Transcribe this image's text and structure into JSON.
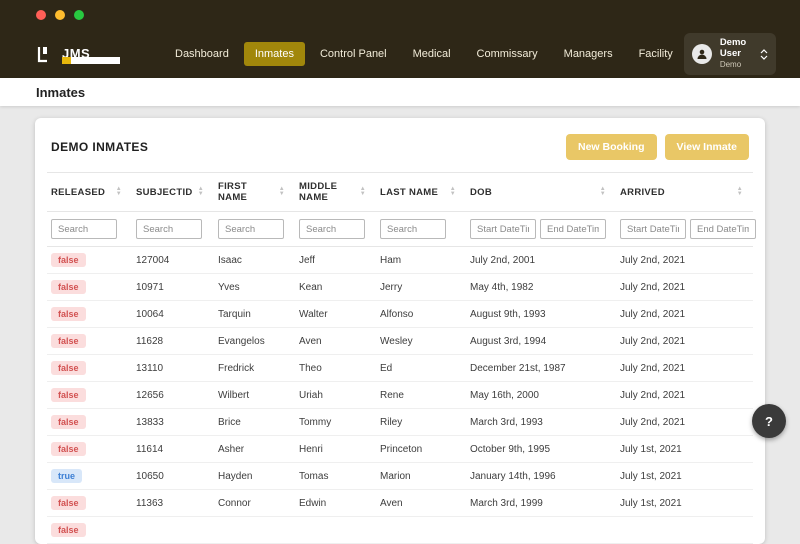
{
  "window": {
    "traffic_lights": [
      {
        "name": "close",
        "color": "#ff5f57"
      },
      {
        "name": "minimize",
        "color": "#febc2e"
      },
      {
        "name": "zoom",
        "color": "#28c840"
      }
    ]
  },
  "header": {
    "logo_text": "JMS",
    "nav": [
      {
        "label": "Dashboard",
        "active": false
      },
      {
        "label": "Inmates",
        "active": true
      },
      {
        "label": "Control Panel",
        "active": false
      },
      {
        "label": "Medical",
        "active": false
      },
      {
        "label": "Commissary",
        "active": false
      },
      {
        "label": "Managers",
        "active": false
      },
      {
        "label": "Facility",
        "active": false
      }
    ],
    "user": {
      "name": "Demo User",
      "role": "Demo"
    },
    "colors": {
      "bar": "#2e2717",
      "active_nav": "#a1870b"
    }
  },
  "breadcrumb": {
    "title": "Inmates"
  },
  "panel": {
    "title": "DEMO INMATES",
    "actions": [
      {
        "label": "New Booking"
      },
      {
        "label": "View Inmate"
      }
    ],
    "button_color": "#e9c766"
  },
  "table": {
    "search_placeholder": "Search",
    "date_placeholders": {
      "start": "Start DateTime",
      "end": "End DateTime"
    },
    "columns": [
      {
        "label": "RELEASED",
        "filter": "search"
      },
      {
        "label": "SUBJECTID",
        "filter": "search"
      },
      {
        "label": "FIRST NAME",
        "filter": "search"
      },
      {
        "label": "MIDDLE NAME",
        "filter": "search"
      },
      {
        "label": "LAST NAME",
        "filter": "search"
      },
      {
        "label": "DOB",
        "filter": "daterange"
      },
      {
        "label": "ARRIVED",
        "filter": "daterange"
      }
    ],
    "badge_colors": {
      "false": {
        "bg": "#fbdddd",
        "text": "#d25252"
      },
      "true": {
        "bg": "#d8e7f9",
        "text": "#3d7fd4"
      }
    },
    "rows": [
      {
        "released": "false",
        "subjectid": "127004",
        "first": "Isaac",
        "middle": "Jeff",
        "last": "Ham",
        "dob": "July 2nd, 2001",
        "arrived": "July 2nd, 2021"
      },
      {
        "released": "false",
        "subjectid": "10971",
        "first": "Yves",
        "middle": "Kean",
        "last": "Jerry",
        "dob": "May 4th, 1982",
        "arrived": "July 2nd, 2021"
      },
      {
        "released": "false",
        "subjectid": "10064",
        "first": "Tarquin",
        "middle": "Walter",
        "last": "Alfonso",
        "dob": "August 9th, 1993",
        "arrived": "July 2nd, 2021"
      },
      {
        "released": "false",
        "subjectid": "11628",
        "first": "Evangelos",
        "middle": "Aven",
        "last": "Wesley",
        "dob": "August 3rd, 1994",
        "arrived": "July 2nd, 2021"
      },
      {
        "released": "false",
        "subjectid": "13110",
        "first": "Fredrick",
        "middle": "Theo",
        "last": "Ed",
        "dob": "December 21st, 1987",
        "arrived": "July 2nd, 2021"
      },
      {
        "released": "false",
        "subjectid": "12656",
        "first": "Wilbert",
        "middle": "Uriah",
        "last": "Rene",
        "dob": "May 16th, 2000",
        "arrived": "July 2nd, 2021"
      },
      {
        "released": "false",
        "subjectid": "13833",
        "first": "Brice",
        "middle": "Tommy",
        "last": "Riley",
        "dob": "March 3rd, 1993",
        "arrived": "July 2nd, 2021"
      },
      {
        "released": "false",
        "subjectid": "11614",
        "first": "Asher",
        "middle": "Henri",
        "last": "Princeton",
        "dob": "October 9th, 1995",
        "arrived": "July 1st, 2021"
      },
      {
        "released": "true",
        "subjectid": "10650",
        "first": "Hayden",
        "middle": "Tomas",
        "last": "Marion",
        "dob": "January 14th, 1996",
        "arrived": "July 1st, 2021"
      },
      {
        "released": "false",
        "subjectid": "11363",
        "first": "Connor",
        "middle": "Edwin",
        "last": "Aven",
        "dob": "March 3rd, 1999",
        "arrived": "July 1st, 2021"
      },
      {
        "released": "false",
        "subjectid": "",
        "first": "",
        "middle": "",
        "last": "",
        "dob": "",
        "arrived": ""
      }
    ]
  },
  "help": {
    "label": "?"
  }
}
